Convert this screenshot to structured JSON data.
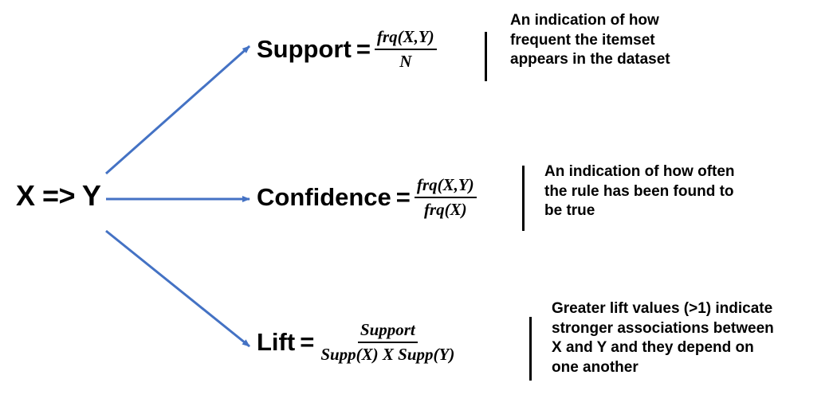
{
  "rule": "X => Y",
  "colors": {
    "arrow": "#4472C4",
    "text": "#000000"
  },
  "metrics": [
    {
      "name": "Support",
      "equals": "=",
      "numerator": "frq(X,Y)",
      "denominator": "N",
      "description": "An indication of how\nfrequent the itemset\nappears in the dataset"
    },
    {
      "name": "Confidence",
      "equals": "=",
      "numerator": "frq(X,Y)",
      "denominator": "frq(X)",
      "description": "An indication of how often\nthe rule has been found to\nbe true"
    },
    {
      "name": "Lift",
      "equals": "=",
      "numerator": "Support",
      "denominator": "Supp(X) X Supp(Y)",
      "description": "Greater lift values (>1) indicate\nstronger associations between\nX and Y and they depend on\none another"
    }
  ]
}
